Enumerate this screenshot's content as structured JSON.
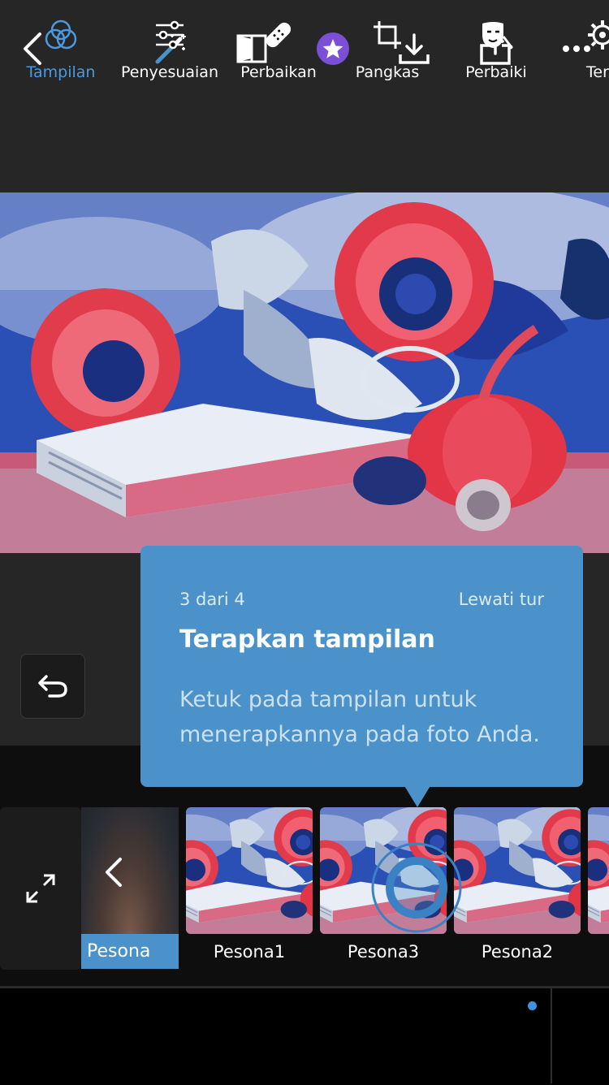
{
  "colors": {
    "accent": "#4a92c9",
    "active_tab": "#4a9ae0",
    "premium_badge": "#7b4fd6",
    "notification_dot": "#3d92e6"
  },
  "topbar": {
    "icons": [
      "back-icon",
      "auto-magic-wand-icon",
      "compare-icon",
      "premium-star-icon",
      "download-icon",
      "share-icon",
      "more-icon"
    ]
  },
  "looks": {
    "back_label": "Pesona",
    "items": [
      {
        "label": "Pesona1"
      },
      {
        "label": "Pesona3"
      },
      {
        "label": "Pesona2"
      }
    ]
  },
  "tour": {
    "step": "3 dari 4",
    "skip": "Lewati tur",
    "title": "Terapkan tampilan",
    "body": "Ketuk pada tampilan untuk menerapkannya pada foto Anda."
  },
  "bottom_tabs": [
    {
      "label": "Tampilan",
      "icon": "looks-circles-icon",
      "active": true
    },
    {
      "label": "Penyesuaian",
      "icon": "sliders-icon",
      "active": false
    },
    {
      "label": "Perbaikan",
      "icon": "bandage-icon",
      "active": false
    },
    {
      "label": "Pangkas",
      "icon": "crop-icon",
      "active": false
    },
    {
      "label": "Perbaiki",
      "icon": "retouch-face-icon",
      "active": false
    },
    {
      "label": "Ter",
      "icon": "settings-gear-icon",
      "active": false
    }
  ]
}
